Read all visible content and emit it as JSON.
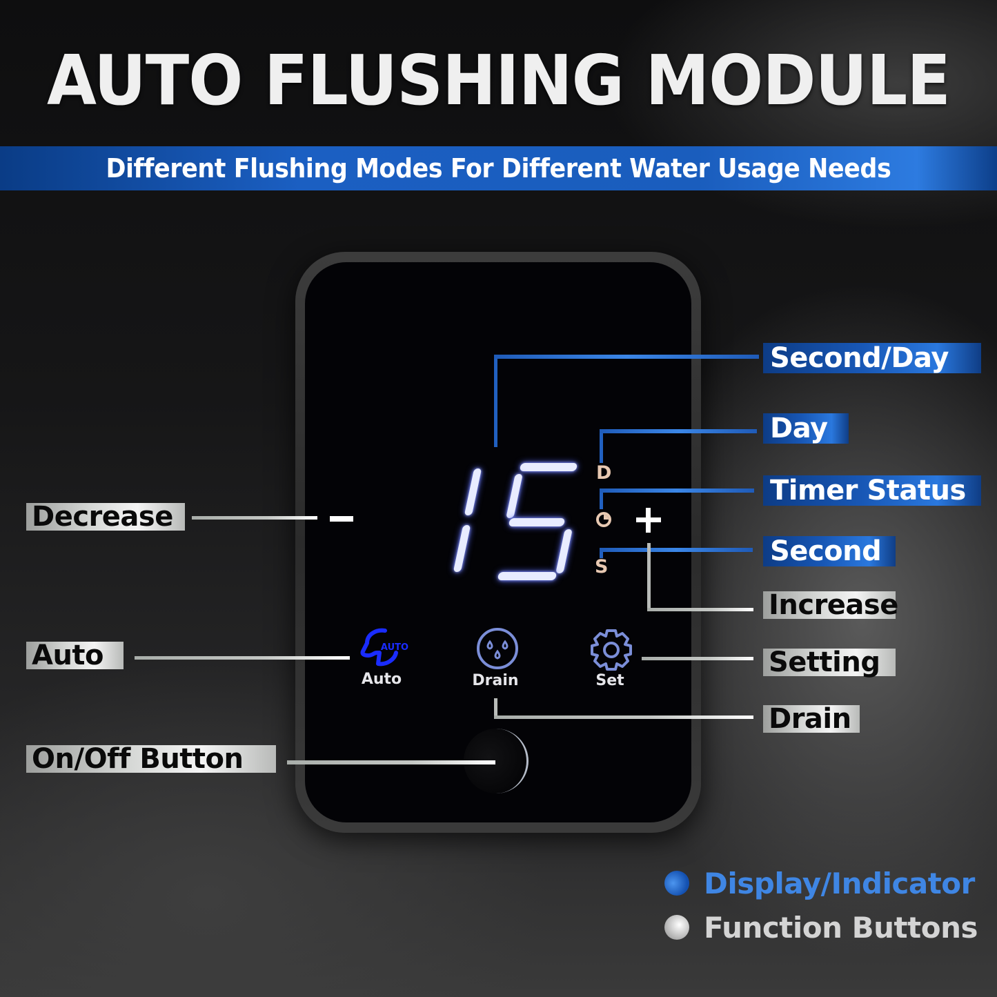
{
  "header": {
    "title": "AUTO FLUSHING MODULE",
    "subtitle": "Different Flushing Modes For Different Water Usage Needs"
  },
  "device": {
    "display_value": "15",
    "unit_indicators": {
      "day": "D",
      "second": "S"
    },
    "timer_indicator_icon": "timer-clock-icon",
    "decrease_symbol": "−",
    "increase_symbol": "+",
    "buttons": [
      {
        "id": "auto",
        "label": "Auto",
        "icon": "auto-refresh-icon",
        "icon_text": "AUTO"
      },
      {
        "id": "drain",
        "label": "Drain",
        "icon": "water-drops-icon"
      },
      {
        "id": "set",
        "label": "Set",
        "icon": "gear-icon"
      }
    ],
    "power_button_icon": "power-button-icon"
  },
  "callouts": {
    "display_indicators": [
      {
        "label": "Second/Day"
      },
      {
        "label": "Day"
      },
      {
        "label": "Timer Status"
      },
      {
        "label": "Second"
      }
    ],
    "function_buttons_right": [
      {
        "label": "Increase"
      },
      {
        "label": "Setting"
      },
      {
        "label": "Drain"
      }
    ],
    "function_buttons_left": [
      {
        "label": "Decrease"
      },
      {
        "label": "Auto"
      },
      {
        "label": "On/Off Button"
      }
    ]
  },
  "legend": {
    "items": [
      {
        "label": "Display/Indicator",
        "color": "#3f86e4"
      },
      {
        "label": "Function Buttons",
        "color": "#d6d6d6"
      }
    ]
  },
  "colors": {
    "accent_blue": "#1b5fc2",
    "display_glow": "#5a6cff",
    "auto_icon": "#1a2cff",
    "indicator_letters": "#e8c9b2"
  }
}
